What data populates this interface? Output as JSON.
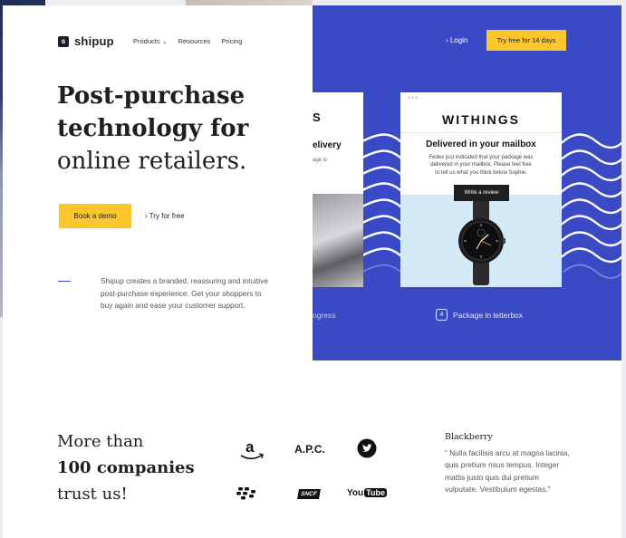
{
  "header": {
    "logo_text": "shipup",
    "nav": [
      "Products",
      "Resources",
      "Pricing"
    ],
    "login": "Login",
    "trial_button": "Try free for 14 days"
  },
  "hero": {
    "headline_line1": "Post-purchase",
    "headline_line2": "technology for",
    "headline_line3": "online retailers.",
    "demo_button": "Book a demo",
    "try_link": "Try for free",
    "description": "Shipup creates a branded, reassuring and intuitive post-purchase experience. Get your shoppers to buy again and ease your customer support."
  },
  "showcase": {
    "left_card": {
      "brand_fragment": "S",
      "title_fragment": "elivery",
      "text_fragment": "age is"
    },
    "main_card": {
      "brand": "WITHINGS",
      "title": "Delivered in your mailbox",
      "message": "Fedex just indicated that your package was delivered in your mailbox. Please feel free to tell us what you think below Sophie.",
      "review_button": "Write a review"
    },
    "step_left": "ogress",
    "step_main_number": "4",
    "step_main_label": "Package in letterbox"
  },
  "social_proof": {
    "line1": "More than",
    "line2": "100 companies",
    "line3": "trust us!",
    "logos": [
      "amazon-logo",
      "apc-logo",
      "twitter-logo",
      "blackberry-logo",
      "sncf-logo",
      "youtube-logo"
    ],
    "apc_text": "A.P.C.",
    "sncf_text": "SNCF",
    "youtube_you": "You",
    "youtube_tube": "Tube"
  },
  "testimonial": {
    "author": "Blackberry",
    "quote": "“ Nulla facilisis arcu at magna lacinia, quis pretium risus tempus. Integer mattis justo quis dui pretium vulputate. Vestibulum egestas.”"
  },
  "colors": {
    "accent_yellow": "#fcc62c",
    "brand_blue": "#3a4ac4",
    "card_light_blue": "#d3e9f7"
  }
}
